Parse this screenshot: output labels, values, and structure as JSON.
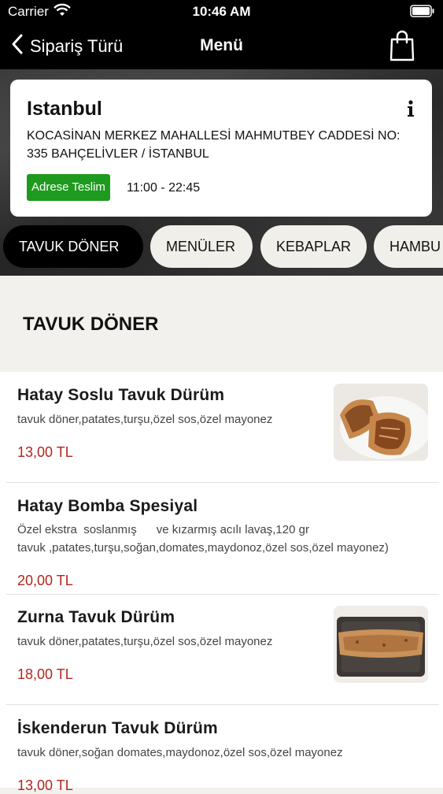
{
  "status_bar": {
    "carrier": "Carrier",
    "time": "10:46 AM",
    "icons": [
      "wifi-icon",
      "battery-icon"
    ]
  },
  "nav": {
    "back_label": "Sipariş Türü",
    "title": "Menü",
    "back_icon": "chevron-left-icon",
    "bag_icon": "shopping-bag-icon"
  },
  "store": {
    "name": "Istanbul",
    "address": "KOCASİNAN MERKEZ MAHALLESİ MAHMUTBEY CADDESİ NO: 335 BAHÇELİVLER / İSTANBUL",
    "delivery_label": "Adrese Teslim",
    "hours": "11:00 - 22:45",
    "info_icon": "info-icon",
    "badge_color": "#1e9a1e"
  },
  "tabs": [
    {
      "label": "TAVUK DÖNER",
      "active": true
    },
    {
      "label": "MENÜLER",
      "active": false
    },
    {
      "label": "KEBAPLAR",
      "active": false
    },
    {
      "label": "HAMBU",
      "active": false
    }
  ],
  "section": {
    "title": "TAVUK DÖNER"
  },
  "items": [
    {
      "name": "Hatay Soslu Tavuk Dürüm",
      "description": "tavuk döner,patates,turşu,özel sos,özel mayonez",
      "price": "13,00 TL",
      "image": "wrap-on-plate"
    },
    {
      "name": "Hatay Bomba Spesiyal",
      "description_line1": "Özel ekstra  soslanmış      ve kızarmış acılı lavaş,120 gr",
      "description_line2": "tavuk ,patates,turşu,soğan,domates,maydonoz,özel sos,özel mayonez)",
      "price": "20,00 TL"
    },
    {
      "name": "Zurna Tavuk Dürüm",
      "description": "tavuk döner,patates,turşu,özel sos,özel mayonez",
      "price": "18,00 TL",
      "image": "long-wrap-on-tray"
    },
    {
      "name": "İskenderun Tavuk Dürüm",
      "description": "tavuk döner,soğan domates,maydonoz,özel sos,özel mayonez",
      "price": "13,00 TL"
    }
  ],
  "colors": {
    "price": "#b3261e",
    "nav_bg": "#000000",
    "active_tab": "#000000"
  }
}
